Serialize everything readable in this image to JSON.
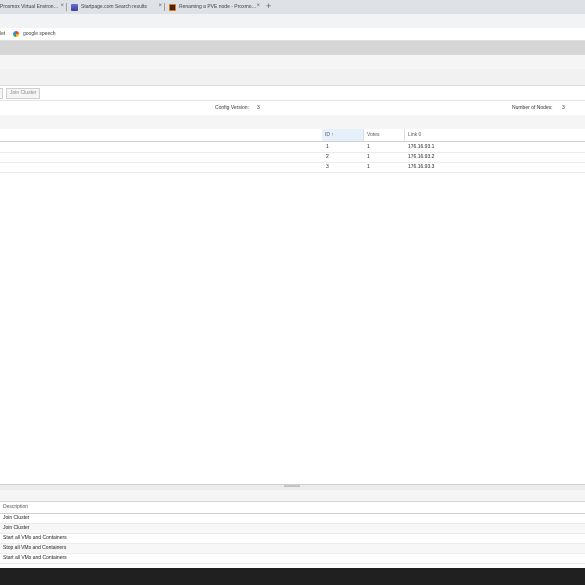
{
  "browser": {
    "tabs": [
      {
        "title": "Proxmox Virtual Environ…",
        "favicon": "proxmox-favicon"
      },
      {
        "title": "Startpage.com Search results",
        "favicon": "startpage-favicon"
      },
      {
        "title": "Renaming a PVE node - Proxmo…",
        "favicon": "forum-favicon"
      }
    ],
    "close_glyph": "×",
    "new_tab_glyph": "+",
    "bookmarks": [
      {
        "label": "let"
      },
      {
        "label": "google speech",
        "icon": "google-icon"
      }
    ]
  },
  "toolbar": {
    "join_cluster_label": "Join Cluster"
  },
  "cluster_info": {
    "config_version_label": "Config Version:",
    "config_version_value": "3",
    "nodes_label": "Number of Nodes:",
    "nodes_value": "3"
  },
  "nodes_grid": {
    "columns": {
      "id": "ID ↑",
      "votes": "Votes",
      "link": "Link 0"
    },
    "rows": [
      {
        "id": "1",
        "votes": "1",
        "link": "176.16.93.1"
      },
      {
        "id": "2",
        "votes": "1",
        "link": "176.16.93.2"
      },
      {
        "id": "3",
        "votes": "1",
        "link": "176.16.93.3"
      }
    ]
  },
  "tasks": {
    "column_description": "Description",
    "rows": [
      "Join Cluster",
      "Join Cluster",
      "Start all VMs and Containers",
      "Stop all VMs and Containers",
      "Start all VMs and Containers"
    ]
  },
  "colors": {
    "tabstrip": "#dee1e6",
    "selected_column": "#e6f0fa",
    "taskbar": "#202020"
  }
}
